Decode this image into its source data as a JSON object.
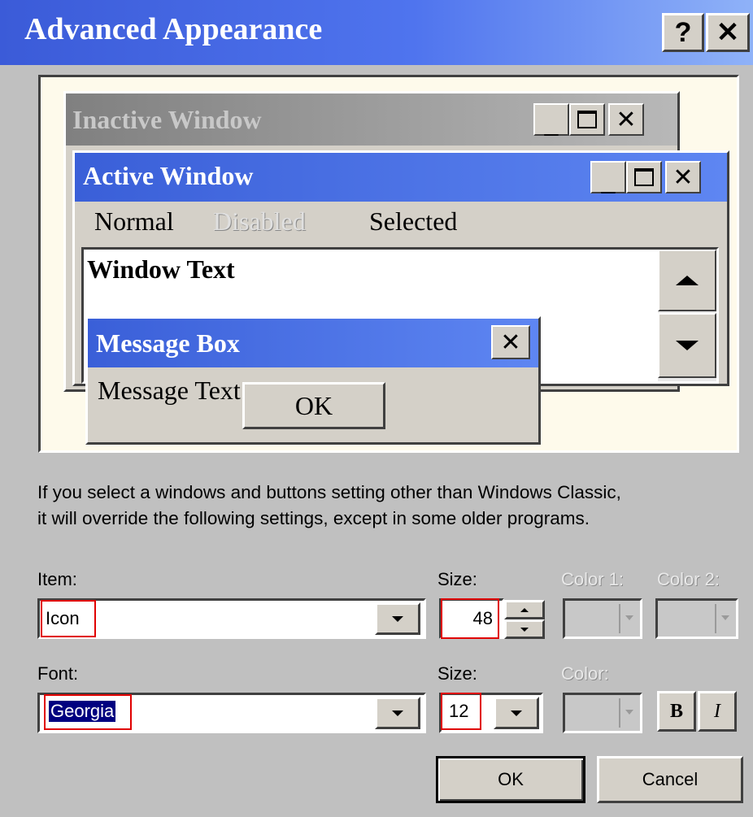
{
  "dialog": {
    "title": "Advanced Appearance",
    "help_label": "?",
    "close_label": "✕"
  },
  "preview": {
    "inactive_title": "Inactive Window",
    "active_title": "Active Window",
    "menu": {
      "normal": "Normal",
      "disabled": "Disabled",
      "selected": "Selected"
    },
    "window_text": "Window Text",
    "message_box_title": "Message Box",
    "message_text": "Message Text",
    "ok_label": "OK"
  },
  "info_text_line1": "If you select a windows and buttons setting other than Windows Classic,",
  "info_text_line2": "it will override the following settings, except in some older programs.",
  "item": {
    "label": "Item:",
    "value": "Icon",
    "size_label": "Size:",
    "size_value": "48",
    "color1_label": "Color 1:",
    "color2_label": "Color 2:"
  },
  "font": {
    "label": "Font:",
    "value": "Georgia",
    "size_label": "Size:",
    "size_value": "12",
    "color_label": "Color:",
    "bold_label": "B",
    "italic_label": "I"
  },
  "buttons": {
    "ok": "OK",
    "cancel": "Cancel"
  },
  "colors": {
    "title_bar_start": "#3b5bd8",
    "title_bar_end": "#8fb2f8",
    "highlight": "#000080",
    "annotation": "#e00000"
  }
}
